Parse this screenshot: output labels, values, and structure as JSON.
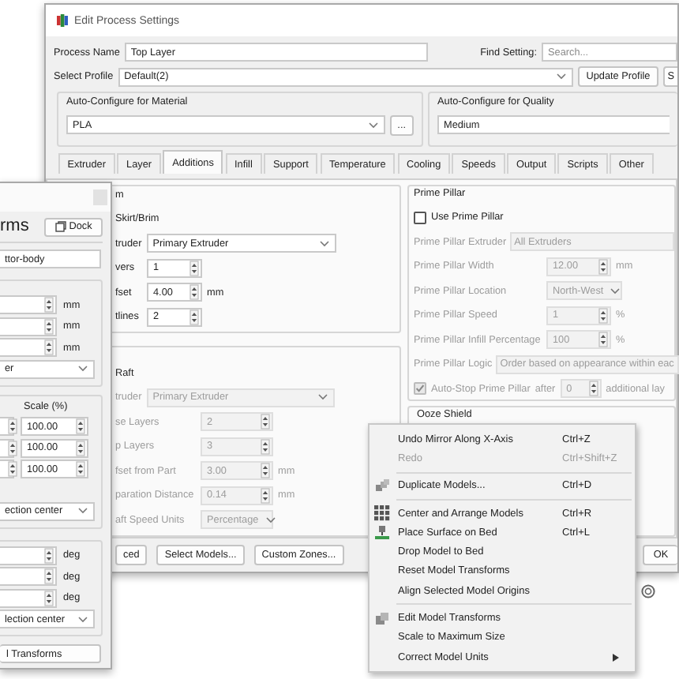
{
  "process_window": {
    "title": "Edit Process Settings",
    "process_name": {
      "label": "Process Name",
      "value": "Top Layer"
    },
    "find_setting": {
      "label": "Find Setting:",
      "placeholder": "Search..."
    },
    "select_profile": {
      "label": "Select Profile",
      "value": "Default(2)"
    },
    "profile_buttons": [
      "Update Profile",
      "S"
    ],
    "material_group": {
      "title": "Auto-Configure for Material",
      "value": "PLA",
      "button": "..."
    },
    "quality_group": {
      "title": "Auto-Configure for Quality",
      "value": "Medium"
    },
    "tabs": [
      {
        "label": "Extruder",
        "selected": false
      },
      {
        "label": "Layer",
        "selected": false
      },
      {
        "label": "Additions",
        "selected": true
      },
      {
        "label": "Infill",
        "selected": false
      },
      {
        "label": "Support",
        "selected": false
      },
      {
        "label": "Temperature",
        "selected": false
      },
      {
        "label": "Cooling",
        "selected": false
      },
      {
        "label": "Speeds",
        "selected": false
      },
      {
        "label": "Output",
        "selected": false
      },
      {
        "label": "Scripts",
        "selected": false
      },
      {
        "label": "Other",
        "selected": false
      }
    ],
    "skirt_group": {
      "title": "m",
      "section_label": "Skirt/Brim",
      "rows": [
        {
          "kind": "combo",
          "label": "truder",
          "value": "Primary Extruder",
          "disabled": false
        },
        {
          "kind": "spin",
          "label": "vers",
          "value": "1",
          "disabled": false
        },
        {
          "kind": "spin",
          "label": "fset",
          "value": "4.00",
          "unit": "mm",
          "disabled": false
        },
        {
          "kind": "spin",
          "label": "tlines",
          "value": "2",
          "disabled": false
        }
      ]
    },
    "raft_group": {
      "section_label": "Raft",
      "rows": [
        {
          "kind": "combo",
          "label": "truder",
          "value": "Primary Extruder",
          "disabled": true
        },
        {
          "kind": "spin",
          "label": "se Layers",
          "value": "2",
          "disabled": true
        },
        {
          "kind": "spin",
          "label": "p Layers",
          "value": "3",
          "disabled": true
        },
        {
          "kind": "spin",
          "label": "fset from Part",
          "value": "3.00",
          "unit": "mm",
          "disabled": true
        },
        {
          "kind": "spin",
          "label": "paration Distance",
          "value": "0.14",
          "unit": "mm",
          "disabled": true
        },
        {
          "kind": "combo",
          "label": "aft Speed Units",
          "value": "Percentage",
          "disabled": true
        }
      ]
    },
    "prime_pillar": {
      "title": "Prime Pillar",
      "use": {
        "label": "Use Prime Pillar",
        "checked": false
      },
      "rows": [
        {
          "kind": "cut-combo",
          "label": "Prime Pillar Extruder",
          "value": "All Extruders",
          "disabled": true
        },
        {
          "kind": "spin",
          "label": "Prime Pillar Width",
          "value": "12.00",
          "unit": "mm",
          "disabled": true
        },
        {
          "kind": "combo",
          "label": "Prime Pillar Location",
          "value": "North-West",
          "disabled": true
        },
        {
          "kind": "spin",
          "label": "Prime Pillar Speed",
          "value": "1",
          "unit": "%",
          "disabled": true
        },
        {
          "kind": "spin",
          "label": "Prime Pillar Infill Percentage",
          "value": "100",
          "unit": "%",
          "disabled": true
        },
        {
          "kind": "cut-combo",
          "label": "Prime Pillar Logic",
          "value": "Order based on appearance within eac",
          "disabled": true
        }
      ],
      "auto_stop": {
        "label": "Auto-Stop Prime Pillar",
        "checked": true,
        "disabled": true,
        "after_label": "after",
        "value": "0",
        "suffix": "additional lay"
      }
    },
    "ooze_shield": {
      "title": "Ooze Shield"
    },
    "bottom_buttons": [
      "ced",
      "Select Models...",
      "Custom Zones..."
    ],
    "ok_button": "OK"
  },
  "transform_panel": {
    "heading": "rms",
    "dock_button": "Dock",
    "object_name": "ttor-body",
    "position_rows": [
      {
        "unit": "mm"
      },
      {
        "unit": "mm"
      },
      {
        "unit": "mm"
      }
    ],
    "position_combo": "er",
    "scale_header": "Scale (%)",
    "scale_rows": [
      {
        "value": "100.00"
      },
      {
        "value": "100.00"
      },
      {
        "value": "100.00"
      }
    ],
    "scale_combo": "ection center",
    "rotation_rows": [
      {
        "unit": "deg"
      },
      {
        "unit": "deg"
      },
      {
        "unit": "deg"
      }
    ],
    "rotation_combo": "lection center",
    "apply_button": "l Transforms"
  },
  "context_menu": {
    "items": [
      {
        "kind": "item",
        "label": "Undo Mirror Along X-Axis",
        "shortcut": "Ctrl+Z",
        "disabled": false
      },
      {
        "kind": "item",
        "label": "Redo",
        "shortcut": "Ctrl+Shift+Z",
        "disabled": true
      },
      {
        "kind": "separator"
      },
      {
        "kind": "item",
        "label": "Duplicate Models...",
        "shortcut": "Ctrl+D",
        "disabled": false
      },
      {
        "kind": "separator"
      },
      {
        "kind": "item",
        "label": "Center and Arrange Models",
        "shortcut": "Ctrl+R",
        "disabled": false
      },
      {
        "kind": "item",
        "label": "Place Surface on Bed",
        "shortcut": "Ctrl+L",
        "disabled": false
      },
      {
        "kind": "item",
        "label": "Drop Model to Bed",
        "disabled": false
      },
      {
        "kind": "item",
        "label": "Reset Model Transforms",
        "disabled": false
      },
      {
        "kind": "item",
        "label": "Align Selected Model Origins",
        "disabled": false
      },
      {
        "kind": "separator"
      },
      {
        "kind": "item",
        "label": "Edit Model Transforms",
        "disabled": false
      },
      {
        "kind": "item",
        "label": "Scale to Maximum Size",
        "disabled": false
      },
      {
        "kind": "submenu",
        "label": "Correct Model Units",
        "disabled": false
      }
    ]
  }
}
